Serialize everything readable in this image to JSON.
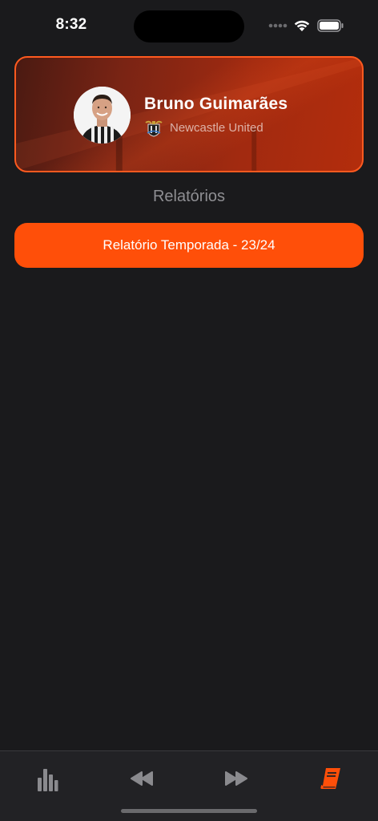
{
  "status_bar": {
    "time": "8:32"
  },
  "player": {
    "name": "Bruno Guimarães",
    "club": "Newcastle United",
    "avatar_icon": "player-photo",
    "club_icon": "newcastle-crest-icon"
  },
  "section": {
    "title": "Relatórios"
  },
  "reports": [
    {
      "label": "Relatório Temporada - 23/24"
    }
  ],
  "tab_bar": {
    "items": [
      {
        "icon": "bar-chart-icon",
        "active": false
      },
      {
        "icon": "rewind-icon",
        "active": false
      },
      {
        "icon": "fast-forward-icon",
        "active": false
      },
      {
        "icon": "book-icon",
        "active": true
      }
    ]
  },
  "colors": {
    "accent": "#ff4f09",
    "background": "#1a1a1c",
    "inactive_icon": "#8a8a8e"
  }
}
